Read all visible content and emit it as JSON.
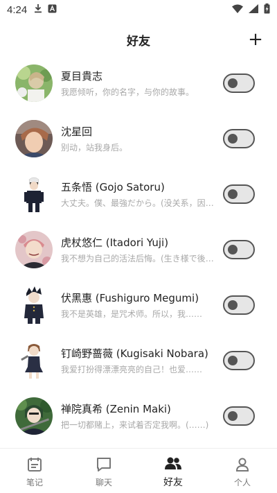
{
  "status_bar": {
    "time": "4:24"
  },
  "header": {
    "title": "好友",
    "add_label": "+"
  },
  "friends": [
    {
      "name": "夏目貴志",
      "desc": "我愿倾听，你的名字，与你的故事。",
      "enabled": false
    },
    {
      "name": "沈星回",
      "desc": "别动，站我身后。",
      "enabled": false
    },
    {
      "name": "五条悟 (Gojo Satoru)",
      "desc": "大丈夫。僕、最強だから。(没关系，因为我是最强的)",
      "enabled": false
    },
    {
      "name": "虎杖悠仁 (Itadori Yuji)",
      "desc": "我不想为自己的活法后悔。(生き様で後悔はしたくない)",
      "enabled": false
    },
    {
      "name": "伏黑惠 (Fushiguro Megumi)",
      "desc": "我不是英雄，是咒术师。所以，我……",
      "enabled": false
    },
    {
      "name": "钉崎野蔷薇 (Kugisaki Nobara)",
      "desc": "我爱打扮得漂漂亮亮的自己！也爱……",
      "enabled": false
    },
    {
      "name": "禅院真希 (Zenin Maki)",
      "desc": "把一切都赌上，来试着否定我啊。(……)",
      "enabled": false
    }
  ],
  "tabs": [
    {
      "label": "笔记",
      "icon": "notebook-icon",
      "active": false
    },
    {
      "label": "聊天",
      "icon": "chat-bubble-icon",
      "active": false
    },
    {
      "label": "好友",
      "icon": "friends-icon",
      "active": true
    },
    {
      "label": "个人",
      "icon": "person-icon",
      "active": false
    }
  ],
  "colors": {
    "accent": "#222222",
    "toggle_track": "#e6e6e6",
    "toggle_border": "#555555",
    "muted_text": "#a8a8a8"
  }
}
